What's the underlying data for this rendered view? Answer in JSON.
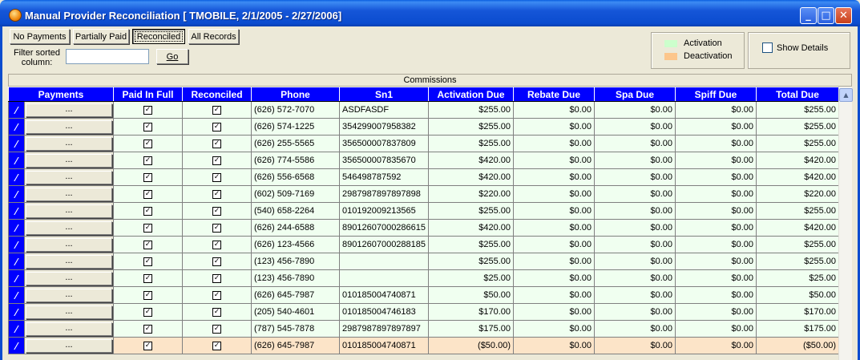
{
  "window": {
    "title": "Manual Provider Reconciliation [ TMOBILE, 2/1/2005 - 2/27/2006]",
    "minimize_icon": "minimize-icon",
    "maximize_icon": "maximize-icon",
    "close_icon": "close-icon"
  },
  "filters": {
    "no_payments": "No Payments",
    "partially_paid": "Partially Paid",
    "reconciled": "Reconciled",
    "all_records": "All Records",
    "active": "Reconciled"
  },
  "filter_sorted": {
    "label": "Filter sorted column:",
    "value": "",
    "go_label": "Go"
  },
  "legend": {
    "activation_label": "Activation",
    "activation_color": "#ccffcc",
    "deactivation_label": "Deactivation",
    "deactivation_color": "#fcc68c"
  },
  "show_details": {
    "label": "Show Details",
    "checked": false
  },
  "grid": {
    "group_header": "Commissions",
    "columns": [
      "Payments",
      "Paid In Full",
      "Reconciled",
      "Phone",
      "Sn1",
      "Activation Due",
      "Rebate  Due",
      "Spa Due",
      "Spiff Due",
      "Total Due"
    ],
    "payment_button_label": "...",
    "rows": [
      {
        "phone": "(626) 572-7070",
        "sn1": "ASDFASDF",
        "activation": "$255.00",
        "rebate": "$0.00",
        "spa": "$0.00",
        "spiff": "$0.00",
        "total": "$255.00",
        "paid": true,
        "reconciled": true,
        "type": "activation"
      },
      {
        "phone": "(626) 574-1225",
        "sn1": "354299007958382",
        "activation": "$255.00",
        "rebate": "$0.00",
        "spa": "$0.00",
        "spiff": "$0.00",
        "total": "$255.00",
        "paid": true,
        "reconciled": true,
        "type": "activation"
      },
      {
        "phone": "(626) 255-5565",
        "sn1": "356500007837809",
        "activation": "$255.00",
        "rebate": "$0.00",
        "spa": "$0.00",
        "spiff": "$0.00",
        "total": "$255.00",
        "paid": true,
        "reconciled": true,
        "type": "activation"
      },
      {
        "phone": "(626) 774-5586",
        "sn1": "356500007835670",
        "activation": "$420.00",
        "rebate": "$0.00",
        "spa": "$0.00",
        "spiff": "$0.00",
        "total": "$420.00",
        "paid": true,
        "reconciled": true,
        "type": "activation"
      },
      {
        "phone": "(626) 556-6568",
        "sn1": "546498787592",
        "activation": "$420.00",
        "rebate": "$0.00",
        "spa": "$0.00",
        "spiff": "$0.00",
        "total": "$420.00",
        "paid": true,
        "reconciled": true,
        "type": "activation"
      },
      {
        "phone": "(602) 509-7169",
        "sn1": "2987987897897898",
        "activation": "$220.00",
        "rebate": "$0.00",
        "spa": "$0.00",
        "spiff": "$0.00",
        "total": "$220.00",
        "paid": true,
        "reconciled": true,
        "type": "activation"
      },
      {
        "phone": "(540) 658-2264",
        "sn1": "010192009213565",
        "activation": "$255.00",
        "rebate": "$0.00",
        "spa": "$0.00",
        "spiff": "$0.00",
        "total": "$255.00",
        "paid": true,
        "reconciled": true,
        "type": "activation"
      },
      {
        "phone": "(626) 244-6588",
        "sn1": "89012607000286615",
        "activation": "$420.00",
        "rebate": "$0.00",
        "spa": "$0.00",
        "spiff": "$0.00",
        "total": "$420.00",
        "paid": true,
        "reconciled": true,
        "type": "activation"
      },
      {
        "phone": "(626) 123-4566",
        "sn1": "89012607000288185",
        "activation": "$255.00",
        "rebate": "$0.00",
        "spa": "$0.00",
        "spiff": "$0.00",
        "total": "$255.00",
        "paid": true,
        "reconciled": true,
        "type": "activation"
      },
      {
        "phone": "(123) 456-7890",
        "sn1": "",
        "activation": "$255.00",
        "rebate": "$0.00",
        "spa": "$0.00",
        "spiff": "$0.00",
        "total": "$255.00",
        "paid": true,
        "reconciled": true,
        "type": "activation"
      },
      {
        "phone": "(123) 456-7890",
        "sn1": "",
        "activation": "$25.00",
        "rebate": "$0.00",
        "spa": "$0.00",
        "spiff": "$0.00",
        "total": "$25.00",
        "paid": true,
        "reconciled": true,
        "type": "activation"
      },
      {
        "phone": "(626) 645-7987",
        "sn1": "010185004740871",
        "activation": "$50.00",
        "rebate": "$0.00",
        "spa": "$0.00",
        "spiff": "$0.00",
        "total": "$50.00",
        "paid": true,
        "reconciled": true,
        "type": "activation"
      },
      {
        "phone": "(205) 540-4601",
        "sn1": "010185004746183",
        "activation": "$170.00",
        "rebate": "$0.00",
        "spa": "$0.00",
        "spiff": "$0.00",
        "total": "$170.00",
        "paid": true,
        "reconciled": true,
        "type": "activation"
      },
      {
        "phone": "(787) 545-7878",
        "sn1": "2987987897897897",
        "activation": "$175.00",
        "rebate": "$0.00",
        "spa": "$0.00",
        "spiff": "$0.00",
        "total": "$175.00",
        "paid": true,
        "reconciled": true,
        "type": "activation"
      },
      {
        "phone": "(626) 645-7987",
        "sn1": "010185004740871",
        "activation": "($50.00)",
        "rebate": "$0.00",
        "spa": "$0.00",
        "spiff": "$0.00",
        "total": "($50.00)",
        "paid": true,
        "reconciled": true,
        "type": "deactivation"
      }
    ]
  }
}
